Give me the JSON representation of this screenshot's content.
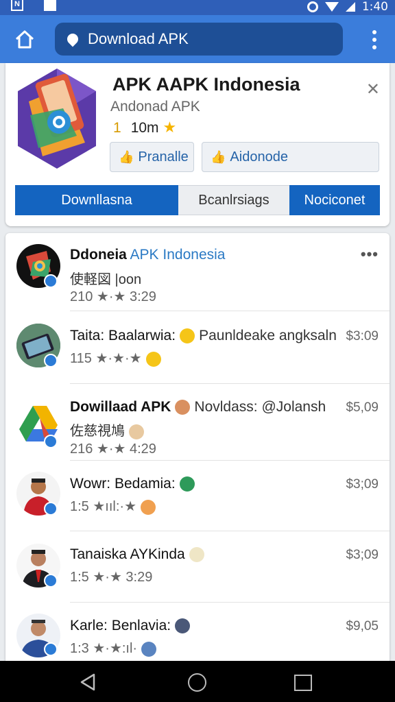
{
  "status_bar": {
    "left_icons": [
      "N",
      ""
    ],
    "time": "1:40",
    "icons": [
      "alarm-icon",
      "wifi-icon",
      "signal-icon"
    ]
  },
  "app_bar": {
    "search_text": "Download APK",
    "home_icon": "home-icon",
    "menu_icon": "more-vert-icon"
  },
  "app_card": {
    "title": "APK AAPK Indonesia",
    "subtitle": "Andonad APK",
    "rating": "1",
    "count": "10m",
    "close_icon": "close-icon",
    "buttons": [
      {
        "label": "Pranalle",
        "icon": "thumbs-up-icon"
      },
      {
        "label": "Aidonode",
        "icon": "thumbs-up-icon"
      }
    ],
    "tabs": [
      "Downllasna",
      "Bcanlrsiags",
      "Nociconet"
    ]
  },
  "list": [
    {
      "title_bold": "Ddoneia",
      "title_rest": "APK Indonesia",
      "line2": "使軽図 |oon",
      "meta": "210 ★·★ 3:29",
      "price": "",
      "more": "•••"
    },
    {
      "title_bold": "Taita: Baalarwia:",
      "title_rest": "Paunldeake angksaln",
      "line2": "",
      "meta": "115 ★·★·★",
      "price": "$3:09"
    },
    {
      "title_bold": "Dowillaad APK",
      "title_rest": "Novldass: @Jolansh",
      "line2": "佐慈視鳩",
      "meta": "216 ★·★ 4:29",
      "price": "$5,09"
    },
    {
      "title_bold": "Wowr: Bedamia:",
      "title_rest": "",
      "line2": "",
      "meta": "1:5 ★ııl:·★",
      "price": "$3;09"
    },
    {
      "title_bold": "Tanaiska AYKinda",
      "title_rest": "",
      "line2": "",
      "meta": "1:5 ★·★ 3:29",
      "price": "$3;09"
    },
    {
      "title_bold": "Karle: Benlavia:",
      "title_rest": "",
      "line2": "",
      "meta": "1:3 ★·★:ıl·",
      "price": "$9,05"
    }
  ],
  "nav_bar": {
    "icons": [
      "back-icon",
      "home-circle-icon",
      "recents-icon"
    ]
  },
  "colors": {
    "status_bar": "#2f5fb8",
    "app_bar": "#3b7ddb",
    "search_bg": "#1e4f96",
    "tab_blue": "#1464c0",
    "accent_blue": "#2a79c4",
    "star": "#f6b400"
  }
}
